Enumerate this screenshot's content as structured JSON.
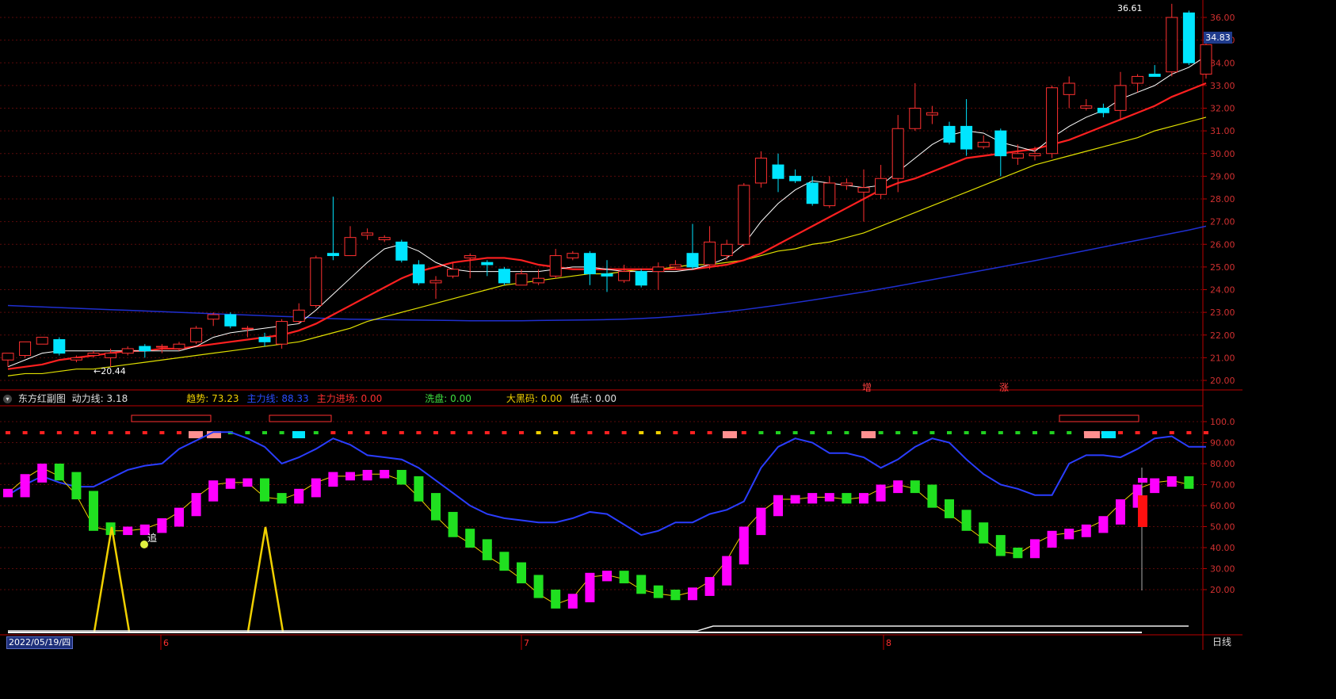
{
  "panel": {
    "title": "东方红副图",
    "items": [
      {
        "label": "动力线: 3.18",
        "color": "#e0e0e0"
      },
      {
        "label": "趋势: 73.23",
        "color": "#f0d000"
      },
      {
        "label": "主力线: 88.33",
        "color": "#2a4dff"
      },
      {
        "label": "主力进场: 0.00",
        "color": "#ff3030"
      },
      {
        "label": "洗盘: 0.00",
        "color": "#40e040"
      },
      {
        "label": "大黑码: 0.00",
        "color": "#f0d000"
      },
      {
        "label": "低点: 0.00",
        "color": "#e0e0e0"
      }
    ]
  },
  "price_axis": {
    "last_price": "34.83",
    "ticks": [
      "36.00",
      "35.00",
      "34.00",
      "33.00",
      "32.00",
      "31.00",
      "30.00",
      "29.00",
      "28.00",
      "27.00",
      "26.00",
      "25.00",
      "24.00",
      "23.00",
      "22.00",
      "21.00",
      "20.00"
    ]
  },
  "indicator_axis": {
    "ticks": [
      "100.0",
      "90.00",
      "80.00",
      "70.00",
      "60.00",
      "50.00",
      "40.00",
      "30.00",
      "20.00"
    ]
  },
  "annotations": {
    "high_label": "36.61",
    "low_label": "20.44",
    "chase_label": "追",
    "zeng_label": "增",
    "zhang_label": "涨"
  },
  "footer": {
    "cursor_date": "2022/05/19/四",
    "period": "日线",
    "month_labels": [
      "6",
      "7",
      "8"
    ]
  },
  "colors": {
    "up": "#ff3030",
    "down": "#00e5ff",
    "ma5": "#ffffff",
    "ma10": "#ff2020",
    "ma20": "#e0e000",
    "ma60": "#1f2fd0",
    "indicator_up": "#ff00ff",
    "indicator_down": "#20e020",
    "trend": "#f0d000",
    "main_line": "#2a3dff"
  },
  "chart_data": {
    "type": "candlestick",
    "candles": [
      [
        20.9,
        21.2,
        20.7,
        20.6
      ],
      [
        21.1,
        21.7,
        21.0,
        21.7
      ],
      [
        21.6,
        21.9,
        21.6,
        21.8
      ],
      [
        21.8,
        21.2,
        21.9,
        21.1
      ],
      [
        20.9,
        21.0,
        21.1,
        20.8
      ],
      [
        21.1,
        21.2,
        21.3,
        21.0
      ],
      [
        21.0,
        21.2,
        21.4,
        20.6
      ],
      [
        21.2,
        21.4,
        21.5,
        21.1
      ],
      [
        21.5,
        21.3,
        21.6,
        21.0
      ],
      [
        21.5,
        21.5,
        21.6,
        21.2
      ],
      [
        21.4,
        21.6,
        21.7,
        21.3
      ],
      [
        21.7,
        22.3,
        22.4,
        21.6
      ],
      [
        22.7,
        22.9,
        23.0,
        22.4
      ],
      [
        22.9,
        22.4,
        23.0,
        22.3
      ],
      [
        22.3,
        22.3,
        22.4,
        21.9
      ],
      [
        21.9,
        21.7,
        22.1,
        21.5
      ],
      [
        21.6,
        22.6,
        22.7,
        21.4
      ],
      [
        22.6,
        23.1,
        23.4,
        22.5
      ],
      [
        23.3,
        25.4,
        25.5,
        23.2
      ],
      [
        25.6,
        25.5,
        28.1,
        25.3
      ],
      [
        25.5,
        26.3,
        26.8,
        25.5
      ],
      [
        26.4,
        26.5,
        26.7,
        26.2
      ],
      [
        26.2,
        26.3,
        26.4,
        26.1
      ],
      [
        26.1,
        25.3,
        26.2,
        25.2
      ],
      [
        25.1,
        24.3,
        25.3,
        24.2
      ],
      [
        24.3,
        24.4,
        24.6,
        23.6
      ],
      [
        24.6,
        24.9,
        25.2,
        24.5
      ],
      [
        25.4,
        25.5,
        25.6,
        24.5
      ],
      [
        25.2,
        25.1,
        25.3,
        24.6
      ],
      [
        24.9,
        24.3,
        25.0,
        24.2
      ],
      [
        24.2,
        24.7,
        24.9,
        24.2
      ],
      [
        24.3,
        24.5,
        24.9,
        24.2
      ],
      [
        24.6,
        25.5,
        25.8,
        24.5
      ],
      [
        25.4,
        25.6,
        25.7,
        25.3
      ],
      [
        25.6,
        24.7,
        25.7,
        24.2
      ],
      [
        24.7,
        24.6,
        25.3,
        23.9
      ],
      [
        24.4,
        24.8,
        25.1,
        24.3
      ],
      [
        24.8,
        24.2,
        24.9,
        24.1
      ],
      [
        24.8,
        25.0,
        25.2,
        24.0
      ],
      [
        25.0,
        25.1,
        25.3,
        24.9
      ],
      [
        25.6,
        25.0,
        26.9,
        24.9
      ],
      [
        25.1,
        26.1,
        26.8,
        24.9
      ],
      [
        25.5,
        26.0,
        26.2,
        25.3
      ],
      [
        26.0,
        28.6,
        28.7,
        25.9
      ],
      [
        28.7,
        29.8,
        30.1,
        28.5
      ],
      [
        29.5,
        28.9,
        30.0,
        28.3
      ],
      [
        29.0,
        28.8,
        29.3,
        28.7
      ],
      [
        28.7,
        27.8,
        29.0,
        27.7
      ],
      [
        27.7,
        28.7,
        29.0,
        27.6
      ],
      [
        28.6,
        28.7,
        28.9,
        28.4
      ],
      [
        28.3,
        28.5,
        29.3,
        27.0
      ],
      [
        28.2,
        28.9,
        29.5,
        28.0
      ],
      [
        28.9,
        31.1,
        31.7,
        28.3
      ],
      [
        31.1,
        32.0,
        33.1,
        31.0
      ],
      [
        31.7,
        31.8,
        32.1,
        31.3
      ],
      [
        31.2,
        30.5,
        31.4,
        30.4
      ],
      [
        31.2,
        30.2,
        32.4,
        29.9
      ],
      [
        30.3,
        30.5,
        30.8,
        30.2
      ],
      [
        31.0,
        29.9,
        31.1,
        29.0
      ],
      [
        29.8,
        30.0,
        30.4,
        29.5
      ],
      [
        29.9,
        30.0,
        30.3,
        29.7
      ],
      [
        30.0,
        32.9,
        33.0,
        29.8
      ],
      [
        32.6,
        33.1,
        33.4,
        32.0
      ],
      [
        32.0,
        32.1,
        32.4,
        31.9
      ],
      [
        32.0,
        31.8,
        32.2,
        31.6
      ],
      [
        31.9,
        33.0,
        33.6,
        31.5
      ],
      [
        33.1,
        33.4,
        33.5,
        32.7
      ],
      [
        33.5,
        33.4,
        33.9,
        33.4
      ],
      [
        33.6,
        36.0,
        36.6,
        33.4
      ],
      [
        36.2,
        34.0,
        36.3,
        33.9
      ],
      [
        33.5,
        34.8,
        34.9,
        33.3
      ]
    ],
    "ma5": [
      20.6,
      20.9,
      21.2,
      21.3,
      21.3,
      21.3,
      21.3,
      21.3,
      21.3,
      21.3,
      21.3,
      21.5,
      21.9,
      22.1,
      22.2,
      22.3,
      22.4,
      22.5,
      23.1,
      23.8,
      24.5,
      25.2,
      25.8,
      26.0,
      25.7,
      25.2,
      24.9,
      24.8,
      24.8,
      24.8,
      24.8,
      24.8,
      24.9,
      25.0,
      25.0,
      24.9,
      24.8,
      24.8,
      24.8,
      24.8,
      24.9,
      25.1,
      25.4,
      26.0,
      27.0,
      27.8,
      28.4,
      28.8,
      28.7,
      28.6,
      28.5,
      28.6,
      29.2,
      29.8,
      30.4,
      30.8,
      31.0,
      30.9,
      30.5,
      30.3,
      30.1,
      30.7,
      31.2,
      31.6,
      31.9,
      32.4,
      32.7,
      33.0,
      33.5,
      33.8,
      34.3
    ],
    "ma10": [
      20.5,
      20.6,
      20.7,
      20.9,
      21.0,
      21.1,
      21.2,
      21.3,
      21.3,
      21.4,
      21.4,
      21.5,
      21.6,
      21.7,
      21.8,
      21.9,
      22.0,
      22.2,
      22.5,
      22.9,
      23.3,
      23.7,
      24.1,
      24.5,
      24.8,
      25.0,
      25.2,
      25.3,
      25.4,
      25.4,
      25.3,
      25.1,
      25.0,
      24.9,
      24.9,
      24.9,
      24.9,
      24.9,
      24.9,
      24.9,
      24.9,
      25.0,
      25.1,
      25.3,
      25.6,
      26.0,
      26.4,
      26.8,
      27.2,
      27.6,
      28.0,
      28.4,
      28.7,
      28.9,
      29.2,
      29.5,
      29.8,
      29.9,
      30.0,
      30.1,
      30.2,
      30.4,
      30.6,
      30.9,
      31.2,
      31.5,
      31.8,
      32.1,
      32.5,
      32.8,
      33.1
    ],
    "ma20": [
      20.2,
      20.3,
      20.3,
      20.4,
      20.5,
      20.5,
      20.6,
      20.7,
      20.8,
      20.9,
      21.0,
      21.1,
      21.2,
      21.3,
      21.4,
      21.5,
      21.6,
      21.7,
      21.9,
      22.1,
      22.3,
      22.6,
      22.8,
      23.0,
      23.2,
      23.4,
      23.6,
      23.8,
      24.0,
      24.2,
      24.3,
      24.4,
      24.5,
      24.6,
      24.7,
      24.7,
      24.8,
      24.9,
      24.9,
      25.0,
      25.1,
      25.1,
      25.2,
      25.3,
      25.5,
      25.7,
      25.8,
      26.0,
      26.1,
      26.3,
      26.5,
      26.8,
      27.1,
      27.4,
      27.7,
      28.0,
      28.3,
      28.6,
      28.9,
      29.2,
      29.5,
      29.7,
      29.9,
      30.1,
      30.3,
      30.5,
      30.7,
      31.0,
      31.2,
      31.4,
      31.6
    ],
    "ma60": [
      23.3,
      23.27,
      23.24,
      23.21,
      23.18,
      23.15,
      23.12,
      23.09,
      23.06,
      23.03,
      23.0,
      22.97,
      22.94,
      22.91,
      22.88,
      22.85,
      22.82,
      22.8,
      22.75,
      22.72,
      22.7,
      22.69,
      22.68,
      22.67,
      22.66,
      22.65,
      22.64,
      22.63,
      22.63,
      22.63,
      22.63,
      22.64,
      22.65,
      22.66,
      22.67,
      22.68,
      22.7,
      22.73,
      22.77,
      22.82,
      22.88,
      22.95,
      23.03,
      23.12,
      23.22,
      23.32,
      23.43,
      23.54,
      23.66,
      23.78,
      23.9,
      24.03,
      24.16,
      24.3,
      24.44,
      24.58,
      24.72,
      24.86,
      25.0,
      25.14,
      25.28,
      25.43,
      25.58,
      25.73,
      25.88,
      26.03,
      26.18,
      26.33,
      26.48,
      26.63,
      26.8
    ],
    "momentum": [
      66,
      73,
      78,
      74,
      65,
      50,
      48,
      48,
      49,
      52,
      57,
      64,
      70,
      71,
      71,
      64,
      63,
      66,
      71,
      74,
      74,
      75,
      75,
      72,
      64,
      55,
      47,
      42,
      36,
      31,
      25,
      18,
      13,
      16,
      26,
      27,
      25,
      20,
      18,
      17,
      19,
      24,
      34,
      48,
      57,
      63,
      63,
      64,
      64,
      63,
      64,
      68,
      70,
      68,
      61,
      56,
      50,
      44,
      38,
      37,
      42,
      46,
      47,
      49,
      53,
      61,
      68,
      71,
      72,
      70
    ],
    "main_line": [
      65,
      70,
      74,
      71,
      69,
      69,
      73,
      77,
      79,
      80,
      87,
      91,
      95,
      95,
      92,
      88,
      80,
      83,
      87,
      92,
      89,
      84,
      83,
      82,
      78,
      72,
      66,
      60,
      56,
      54,
      53,
      52,
      52,
      54,
      57,
      56,
      51,
      46,
      48,
      52,
      52,
      56,
      58,
      62,
      78,
      88,
      92,
      90,
      85,
      85,
      83,
      78,
      82,
      88,
      92,
      90,
      82,
      75,
      70,
      68,
      65,
      65,
      80,
      84,
      84,
      83,
      87,
      92,
      93,
      88,
      88
    ]
  }
}
